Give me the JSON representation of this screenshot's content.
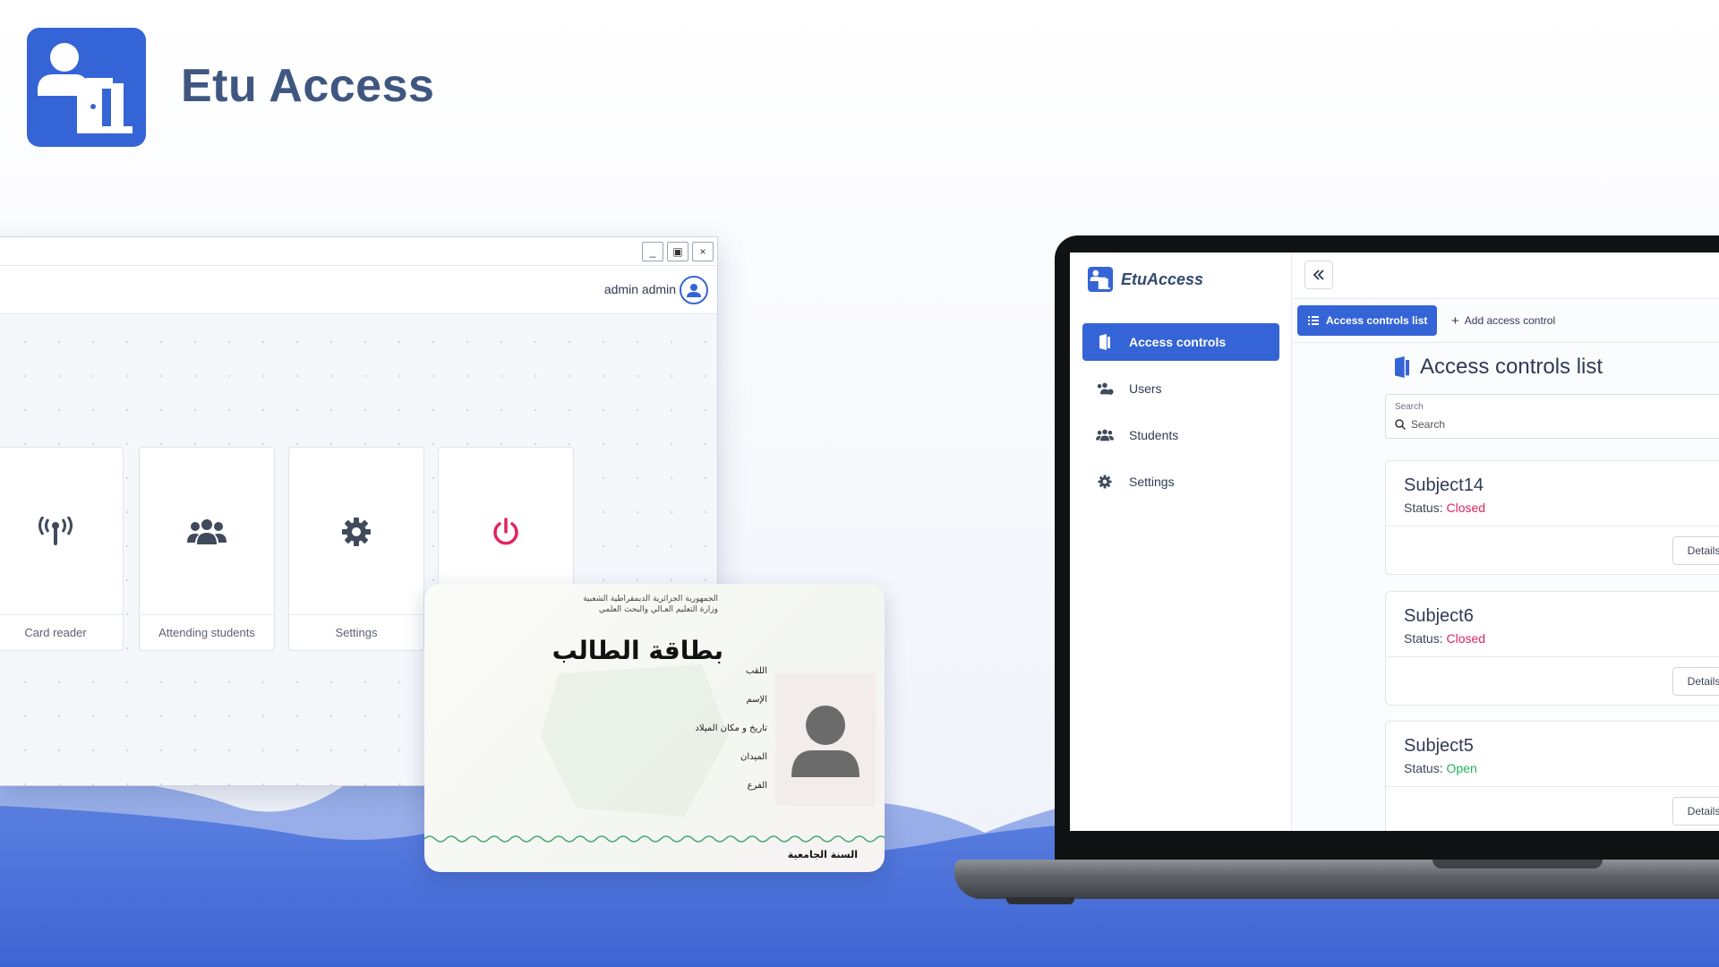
{
  "brand": {
    "title": "Etu Access"
  },
  "desktop": {
    "window_controls": {
      "minimize": "_",
      "maximize": "▣",
      "close": "×"
    },
    "user": {
      "name": "admin admin"
    },
    "tiles": [
      {
        "label": "Card reader",
        "icon": "card-reader-icon"
      },
      {
        "label": "Attending students",
        "icon": "users-icon"
      },
      {
        "label": "Settings",
        "icon": "gear-icon"
      },
      {
        "label": "",
        "icon": "power-icon"
      }
    ],
    "colors": {
      "accent": "#3564d6",
      "power": "#e0245e"
    }
  },
  "student_card": {
    "header_line1": "الجمهورية الجزائرية الديمقراطية الشعبية",
    "header_line2": "وزارة التعليم العـالي والبحث العلمي",
    "title": "بطاقة الطالب",
    "fields": [
      "اللقب",
      "الإسم",
      "تاريخ و مكان الميلاد",
      "الميدان",
      "الفرع"
    ],
    "year_label": "السنة الجامعية"
  },
  "web": {
    "sidebar": {
      "brand": "EtuAccess",
      "items": [
        {
          "label": "Access controls",
          "icon": "door-icon",
          "active": true
        },
        {
          "label": "Users",
          "icon": "users-icon",
          "active": false
        },
        {
          "label": "Students",
          "icon": "students-icon",
          "active": false
        },
        {
          "label": "Settings",
          "icon": "gear-icon",
          "active": false
        }
      ]
    },
    "tabs": {
      "list": "Access controls list",
      "add": "Add access control"
    },
    "page_title": "Access controls list",
    "search": {
      "label": "Search",
      "placeholder": "Search"
    },
    "status_prefix": "Status:",
    "details_label": "Details",
    "access_controls": [
      {
        "name": "Subject14",
        "status": "Closed",
        "status_color": "#e0245e"
      },
      {
        "name": "Subject6",
        "status": "Closed",
        "status_color": "#e0245e"
      },
      {
        "name": "Subject5",
        "status": "Open",
        "status_color": "#22b35e"
      }
    ]
  }
}
